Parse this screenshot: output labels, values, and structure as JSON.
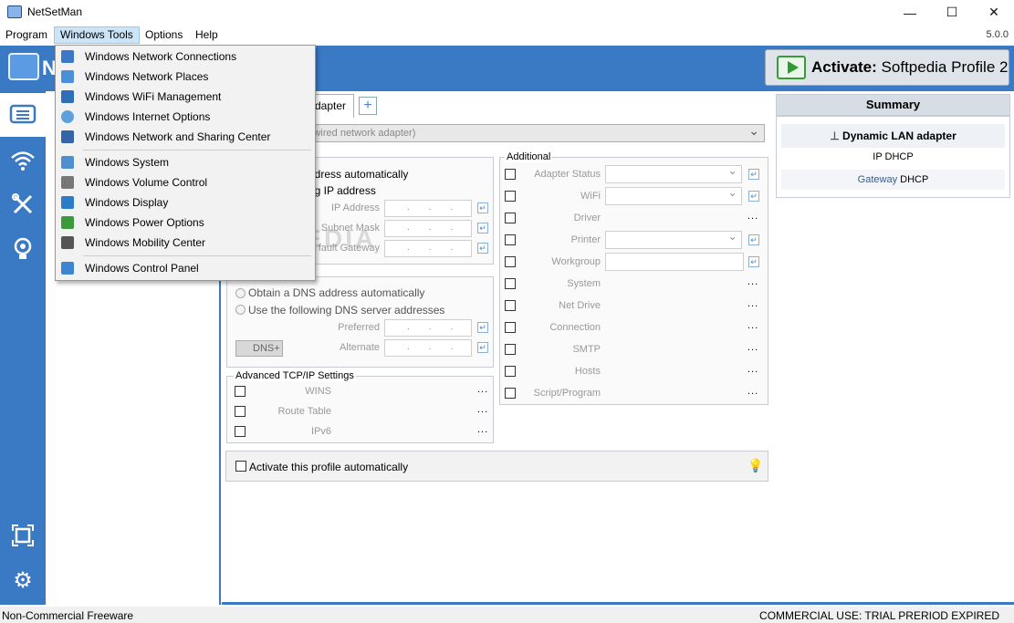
{
  "window": {
    "title": "NetSetMan",
    "minimize_icon": "minimize-icon",
    "maximize_icon": "maximize-icon",
    "close_icon": "close-icon"
  },
  "menubar": {
    "items": [
      "Program",
      "Windows Tools",
      "Options",
      "Help"
    ],
    "active": "Windows Tools",
    "version": "5.0.0"
  },
  "header": {
    "logo_text": "N",
    "activate_label": "Activate:",
    "activate_profile": "Softpedia Profile 2"
  },
  "tabs": {
    "adapter_tab": "dapter"
  },
  "adapter": {
    "selected": "ter",
    "hint": "(First available wired network adapter)"
  },
  "ip": {
    "opt_auto": "ddress automatically",
    "opt_manual": "ng IP address",
    "fields": [
      "IP Address",
      "Subnet Mask",
      "fault Gateway"
    ]
  },
  "dns": {
    "opt_auto": "Obtain a DNS address automatically",
    "opt_manual": "Use the following DNS server addresses",
    "fields": [
      "Preferred",
      "Alternate"
    ],
    "dns_plus": "DNS+"
  },
  "advanced": {
    "title": "Advanced TCP/IP Settings",
    "items": [
      "WINS",
      "Route Table",
      "IPv6"
    ]
  },
  "additional": {
    "title": "Additional",
    "items": [
      "Adapter Status",
      "WiFi",
      "Driver",
      "Printer",
      "Workgroup",
      "System",
      "Net Drive",
      "Connection",
      "SMTP",
      "Hosts",
      "Script/Program"
    ]
  },
  "auto_activate": "Activate this profile automatically",
  "summary": {
    "title": "Summary",
    "adapter": "Dynamic LAN adapter",
    "ip_label": "IP",
    "ip_value": "DHCP",
    "gateway_label": "Gateway",
    "gateway_value": "DHCP"
  },
  "statusbar": {
    "left": "Non-Commercial Freeware",
    "right": "COMMERCIAL USE: TRIAL PRERIOD EXPIRED"
  },
  "windows_tools_menu": {
    "group1": [
      "Windows Network Connections",
      "Windows Network Places",
      "Windows WiFi Management",
      "Windows Internet Options",
      "Windows Network and Sharing Center"
    ],
    "group2": [
      "Windows System",
      "Windows Volume Control",
      "Windows Display",
      "Windows Power Options",
      "Windows Mobility Center"
    ],
    "group3": [
      "Windows Control Panel"
    ]
  },
  "watermark": "SOFTPEDIA",
  "colors": {
    "accent": "#3a79c4",
    "menu_highlight": "#cce4f7",
    "activate_green": "#2e9b2e"
  }
}
